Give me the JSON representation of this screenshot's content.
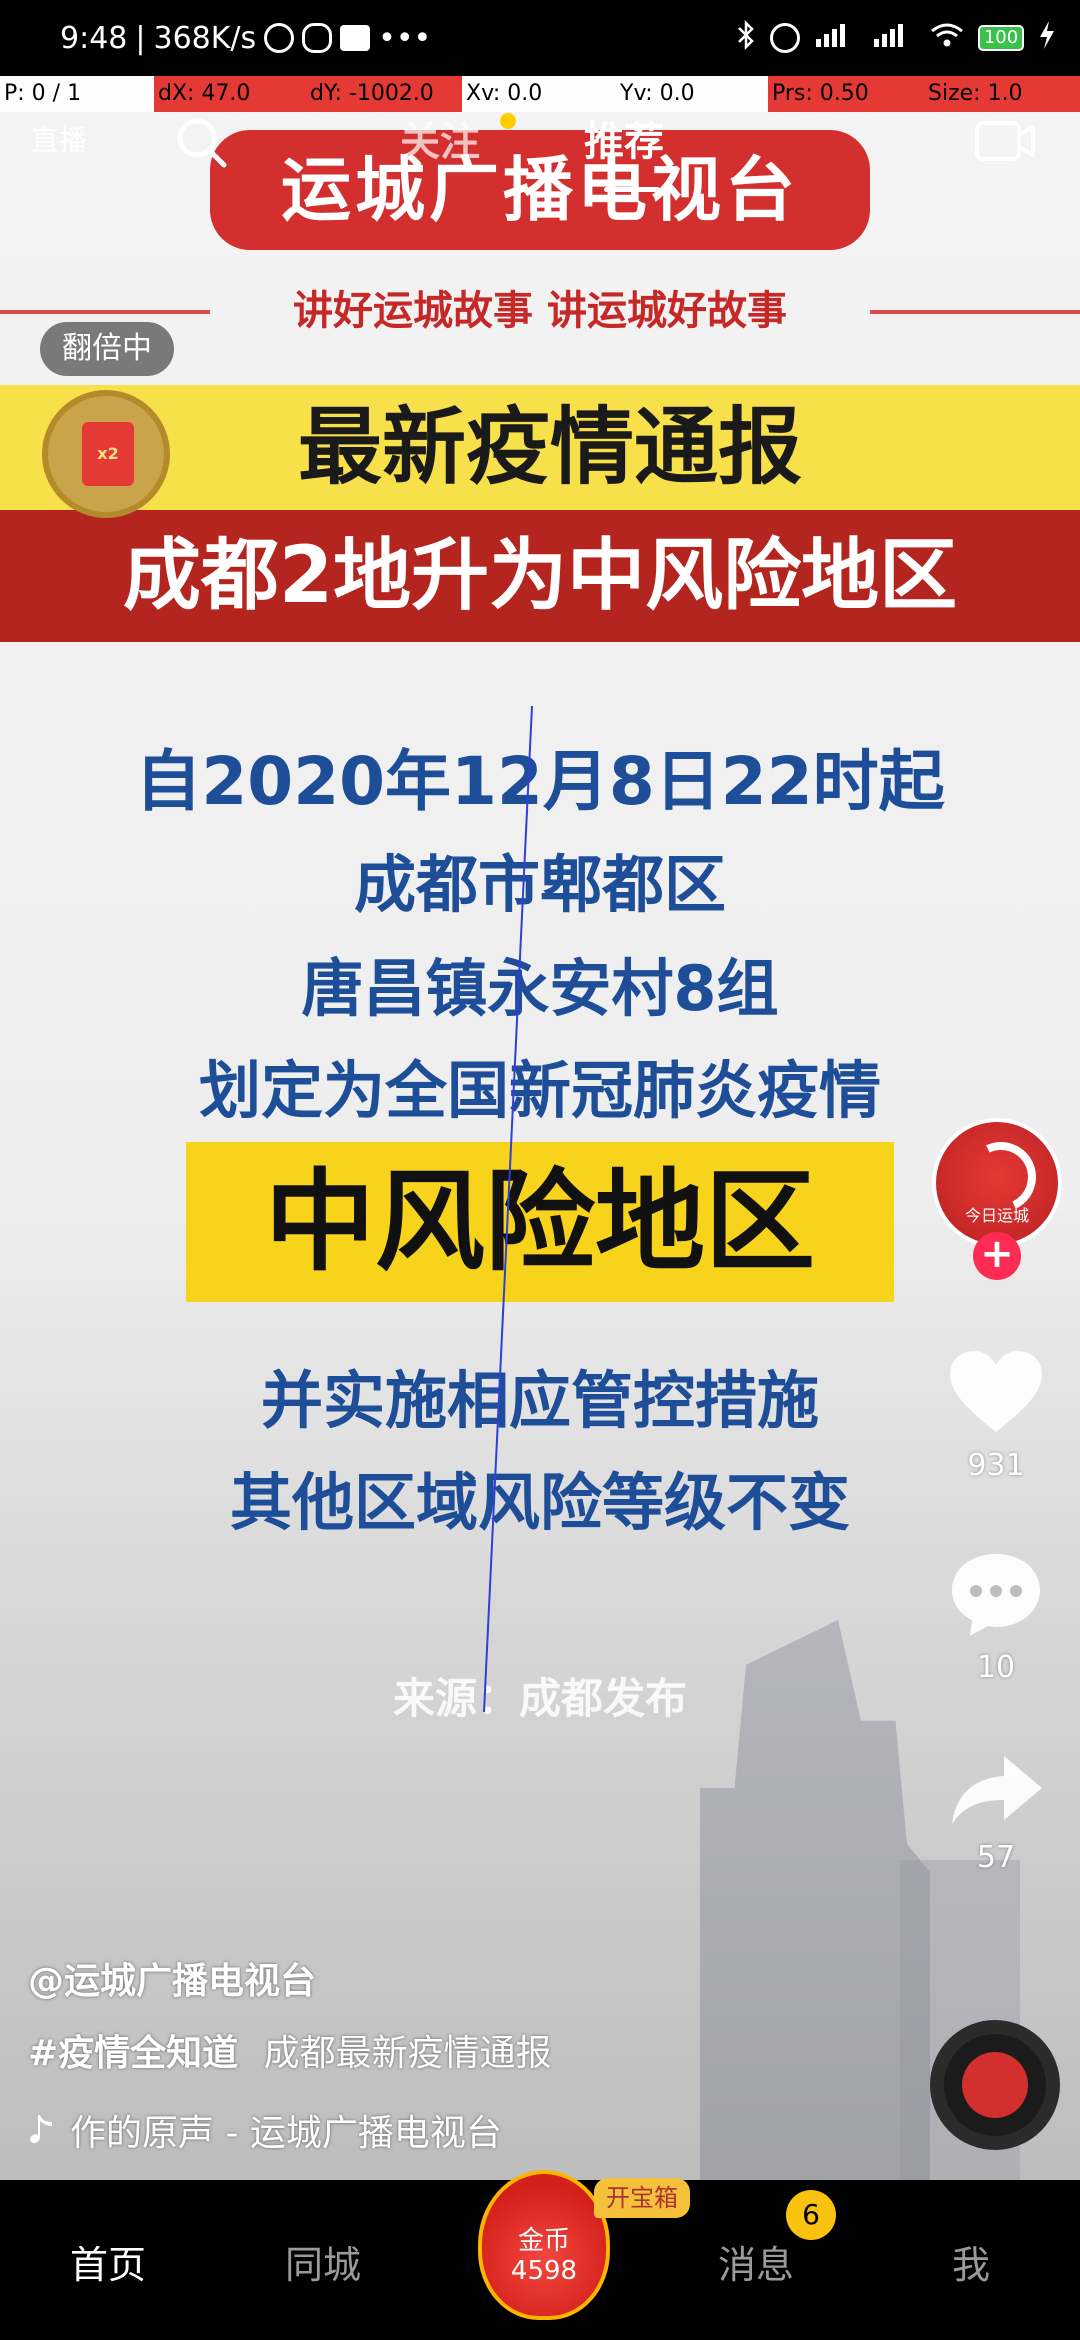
{
  "status_bar": {
    "time": "9:48",
    "network_speed": "368K/s",
    "separator": "|",
    "more": "•••",
    "battery": "100"
  },
  "debug": {
    "pointer": "P: 0 / 1",
    "dx": "dX: 47.0",
    "dy": "dY: -1002.0",
    "xv": "Xv: 0.0",
    "yv": "Yv: 0.0",
    "prs": "Prs: 0.50",
    "size": "Size: 1.0"
  },
  "top_nav": {
    "live": "直播",
    "follow_tab": "关注",
    "recommend_tab": "推荐"
  },
  "video": {
    "channel_banner": "运城广播电视台",
    "slogan": "讲好运城故事  讲运城好故事",
    "double_badge": "翻倍中",
    "redpacket_label": "x2",
    "headline_1": "最新疫情通报",
    "headline_2": "成都2地升为中风险地区",
    "line_1": "自2020年12月8日22时起",
    "line_2": "成都市郫都区",
    "line_3": "唐昌镇永安村8组",
    "line_4": "划定为全国新冠肺炎疫情",
    "risk": "中风险地区",
    "line_5": "并实施相应管控措施",
    "line_6": "其他区域风险等级不变",
    "source": "来源：成都发布"
  },
  "right_rail": {
    "avatar_name": "今日运城",
    "follow_plus": "+",
    "likes": "931",
    "comments": "10",
    "shares": "57"
  },
  "caption": {
    "author": "@运城广播电视台",
    "hashtag": "#疫情全知道",
    "description": "成都最新疫情通报",
    "music": "作的原声 - 运城广播电视台"
  },
  "bottom_nav": {
    "home": "首页",
    "city": "同城",
    "coin_label": "金币",
    "coin_count": "4598",
    "chest": "开宝箱",
    "messages": "消息",
    "message_badge": "6",
    "me": "我"
  },
  "colors": {
    "accent_red": "#fe2c55",
    "headline_yellow": "#f7e04a",
    "headline_red": "#b5251f",
    "body_blue": "#1f4e99",
    "risk_yellow": "#f7d31c"
  }
}
